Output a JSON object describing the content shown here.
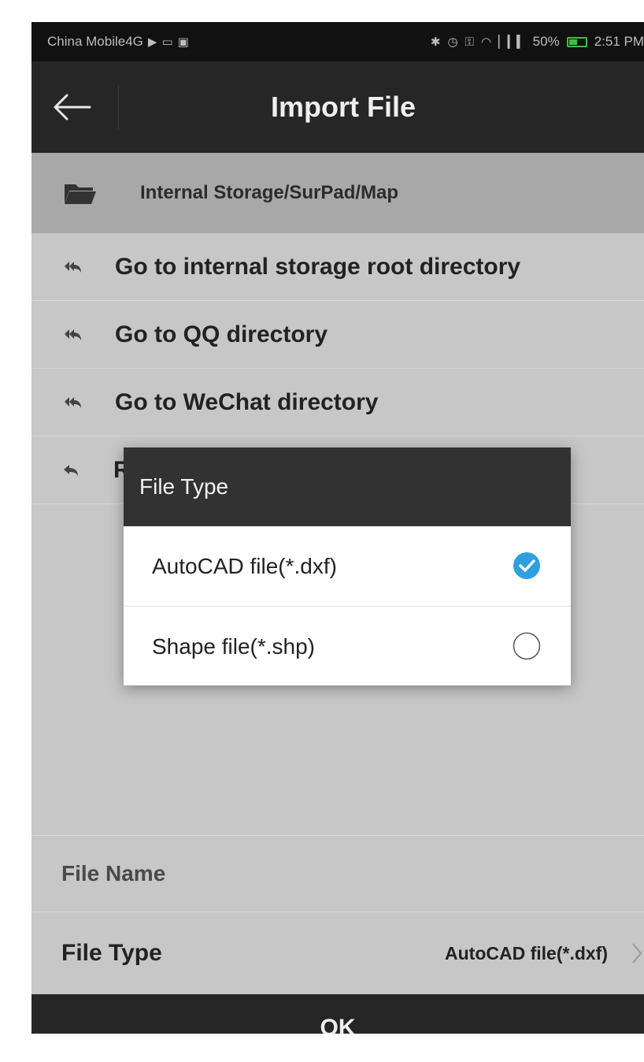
{
  "status_bar": {
    "carrier": "China Mobile4G",
    "battery": "50%",
    "battery_level": 0.5,
    "time": "2:51 PM",
    "icons": [
      "signal-arrow-icon",
      "cast-icon",
      "image-icon",
      "bluetooth-icon",
      "alarm-icon",
      "key-icon",
      "wifi-icon",
      "cellular-icon",
      "battery-icon"
    ]
  },
  "header": {
    "title": "Import File",
    "back_icon": "arrow-left-icon"
  },
  "path": {
    "icon": "folder-icon",
    "text": "Internal Storage/SurPad/Map"
  },
  "nav_items": [
    {
      "label": "Go to internal storage root directory",
      "icon": "reply-all-icon"
    },
    {
      "label": "Go to QQ directory",
      "icon": "reply-all-icon"
    },
    {
      "label": "Go to WeChat directory",
      "icon": "reply-all-icon"
    },
    {
      "label": "R",
      "icon": "reply-icon"
    }
  ],
  "form": {
    "file_name_label": "File Name",
    "file_name_value": "",
    "file_type_label": "File Type",
    "file_type_value": "AutoCAD file(*.dxf)"
  },
  "ok_label": "OK",
  "dialog": {
    "title": "File Type",
    "options": [
      {
        "label": "AutoCAD file(*.dxf)",
        "selected": true
      },
      {
        "label": "Shape file(*.shp)",
        "selected": false
      }
    ]
  },
  "colors": {
    "accent": "#2f9fe0",
    "bar_dark": "#262626",
    "dialog_header": "#323232",
    "background": "#c7c7c7",
    "path_bar": "#a8a8a8",
    "battery_green": "#39c23d"
  }
}
